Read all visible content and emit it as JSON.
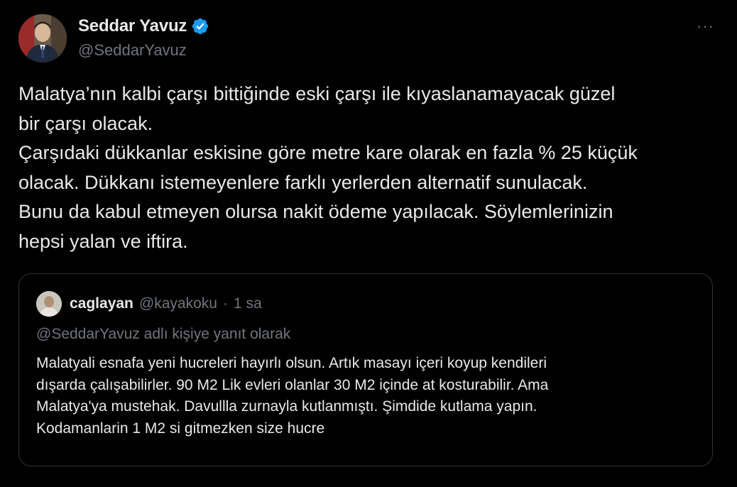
{
  "author": {
    "display_name": "Seddar Yavuz",
    "handle": "@SeddarYavuz",
    "verified": true,
    "avatar_icon": "profile-photo"
  },
  "more_label": "···",
  "tweet": {
    "lines": [
      "Malatya’nın kalbi çarşı bittiğinde eski çarşı ile kıyaslanamayacak güzel",
      "bir çarşı olacak.",
      "Çarşıdaki dükkanlar eskisine göre metre kare olarak en fazla % 25 küçük",
      "olacak. Dükkanı istemeyenlere farklı yerlerden alternatif sunulacak.",
      "Bunu da kabul etmeyen olursa nakit ödeme yapılacak. Söylemlerinizin",
      "hepsi yalan ve iftira."
    ]
  },
  "quoted": {
    "display_name": "caglayan",
    "handle": "@kayakoku",
    "separator": "·",
    "time": "1 sa",
    "reply_context": "@SeddarYavuz adlı kişiye yanıt olarak",
    "lines": [
      "Malatyali esnafa yeni hucreleri hayırlı olsun. Artık masayı içeri koyup kendileri",
      "dışarda çalışabilirler. 90 M2 Lik evleri olanlar 30 M2 içinde at kosturabilir. Ama",
      "Malatya'ya mustehak. Davullla zurnayla kutlanmıştı. Şimdide kutlama yapın.",
      "Kodamanlarin 1 M2 si gitmezken size hucre"
    ]
  },
  "colors": {
    "background": "#000000",
    "text": "#e7e9ea",
    "secondary": "#71767b",
    "verified": "#1d9bf0",
    "border": "#2f3336"
  }
}
